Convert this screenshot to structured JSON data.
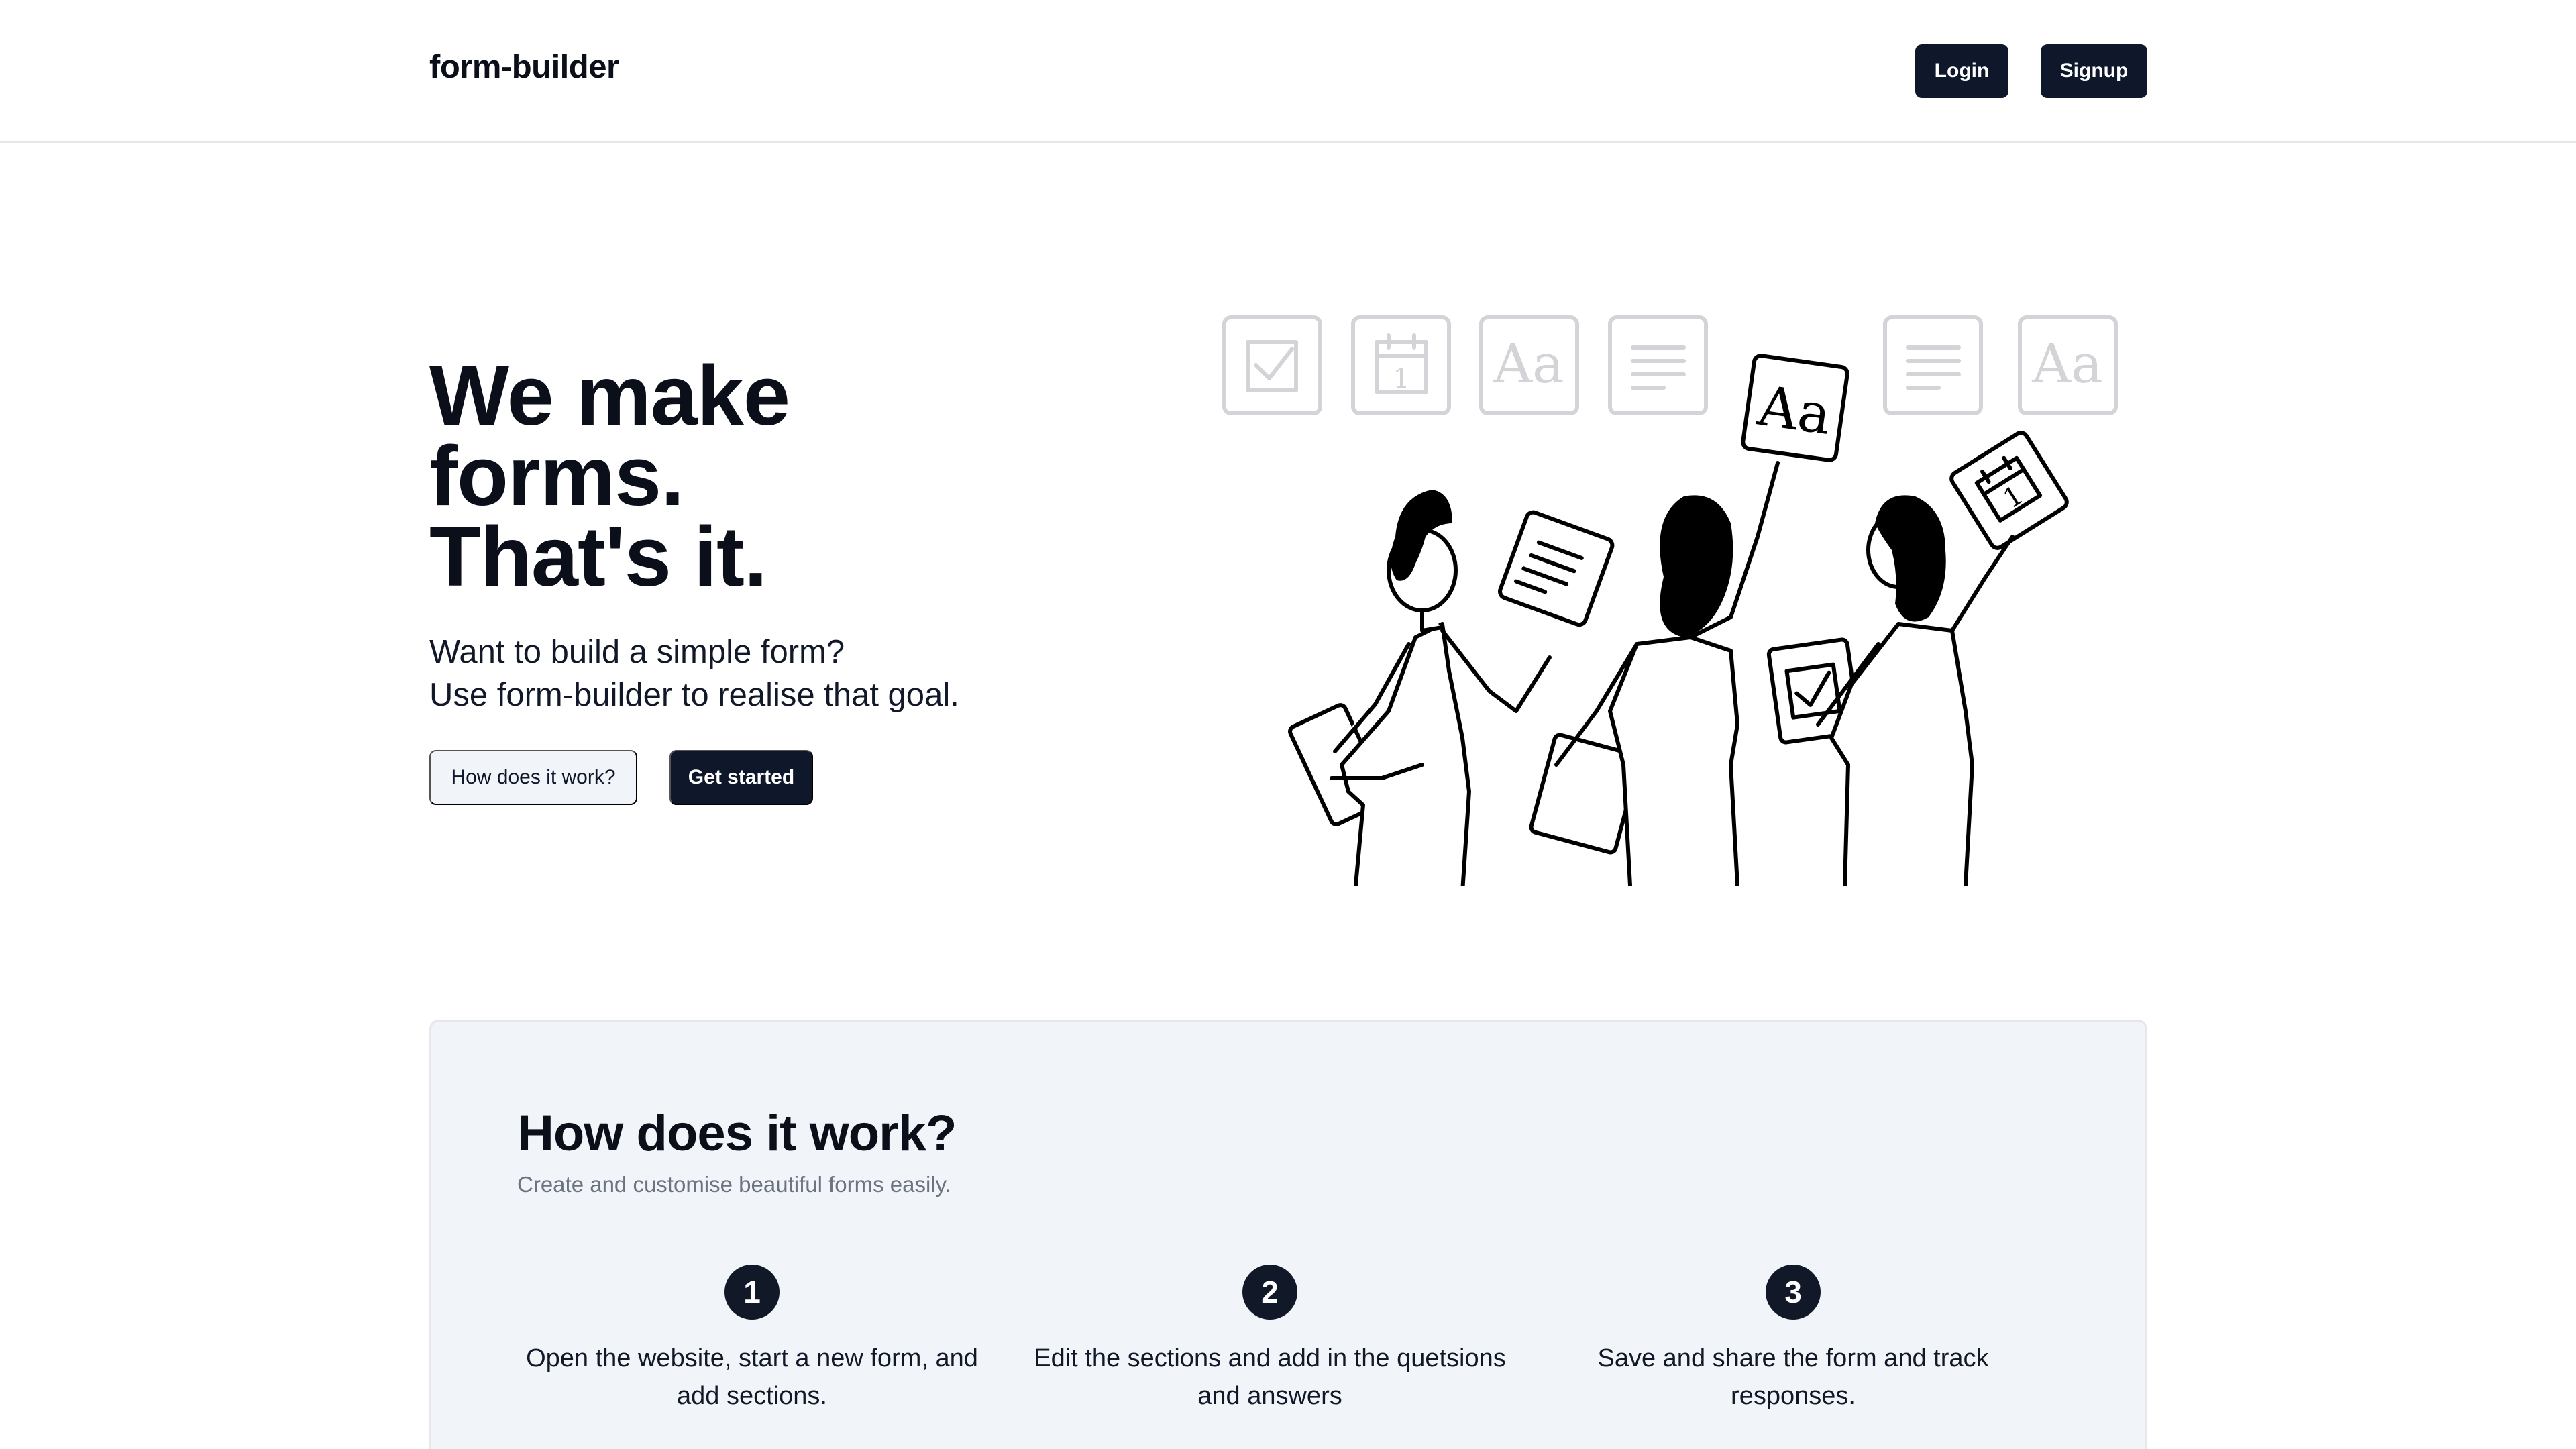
{
  "header": {
    "brand": "form-builder",
    "login_label": "Login",
    "signup_label": "Signup"
  },
  "hero": {
    "title_lines": [
      "We make",
      "forms.",
      "That's it."
    ],
    "subtitle_lines": [
      "Want to build a simple form?",
      "Use form-builder to realise that goal."
    ],
    "secondary_button": "How does it work?",
    "primary_button": "Get started"
  },
  "illustration": {
    "tiles": [
      "checkbox-icon",
      "calendar-icon",
      "text-aa-icon",
      "paragraph-icon",
      "paragraph-icon",
      "text-aa-icon"
    ],
    "tile_text_aa": "Aa",
    "calendar_day": "1",
    "colors": {
      "faded": "#d4d4d8",
      "ink": "#000000"
    }
  },
  "how": {
    "title": "How does it work?",
    "subtitle": "Create and customise beautiful forms easily.",
    "steps": [
      {
        "number": "1",
        "text": "Open the website, start a new form, and add sections."
      },
      {
        "number": "2",
        "text": "Edit the sections and add in the quetsions and answers"
      },
      {
        "number": "3",
        "text": "Save and share the form and track responses."
      }
    ]
  },
  "colors": {
    "primary": "#0f172a",
    "secondary_bg": "#f1f5f9",
    "section_bg": "#f1f4f9",
    "muted_text": "#6b7280"
  }
}
